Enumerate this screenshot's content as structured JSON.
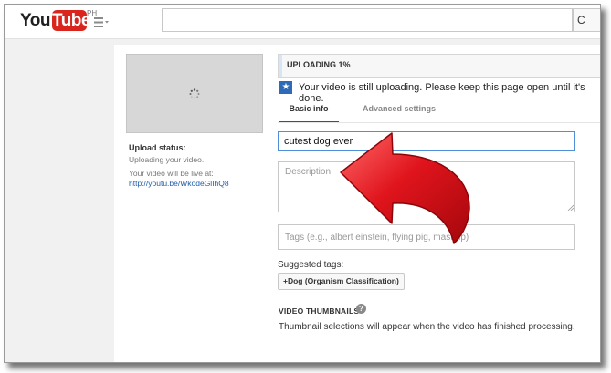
{
  "header": {
    "logo_you": "You",
    "logo_tube": "Tube",
    "logo_region": "PH",
    "search": {
      "value": "",
      "button_label": "C"
    }
  },
  "left": {
    "upload_status_label": "Upload status:",
    "uploading_text": "Uploading your video.",
    "live_text": "Your video will be live at:",
    "video_url": "http://youtu.be/WkodeGlIhQ8"
  },
  "upload": {
    "progress_label": "UPLOADING 1%",
    "progress_fraction": 0.01,
    "info_text": "Your video is still uploading. Please keep this page open until it's done."
  },
  "tabs": [
    {
      "label": "Basic info",
      "active": true
    },
    {
      "label": "Advanced settings",
      "active": false
    }
  ],
  "form": {
    "title_value": "cutest dog ever",
    "description_placeholder": "Description",
    "tags_placeholder": "Tags (e.g., albert einstein, flying pig, mashup)",
    "suggested_tags_label": "Suggested tags:",
    "suggested_tags": [
      "+Dog (Organism Classification)"
    ]
  },
  "thumbnails": {
    "heading": "VIDEO THUMBNAILS",
    "help_glyph": "?",
    "note": "Thumbnail selections will appear when the video has finished processing."
  },
  "icons": {
    "info": "★",
    "arrow": "red-curved-arrow"
  },
  "colors": {
    "brand_red": "#d9251d",
    "tab_underline": "#cc181e",
    "focus_blue": "#4f8ed8",
    "link_blue": "#1f5ea8",
    "info_blue": "#2e6ab5",
    "arrow_red": "#e0141c"
  }
}
